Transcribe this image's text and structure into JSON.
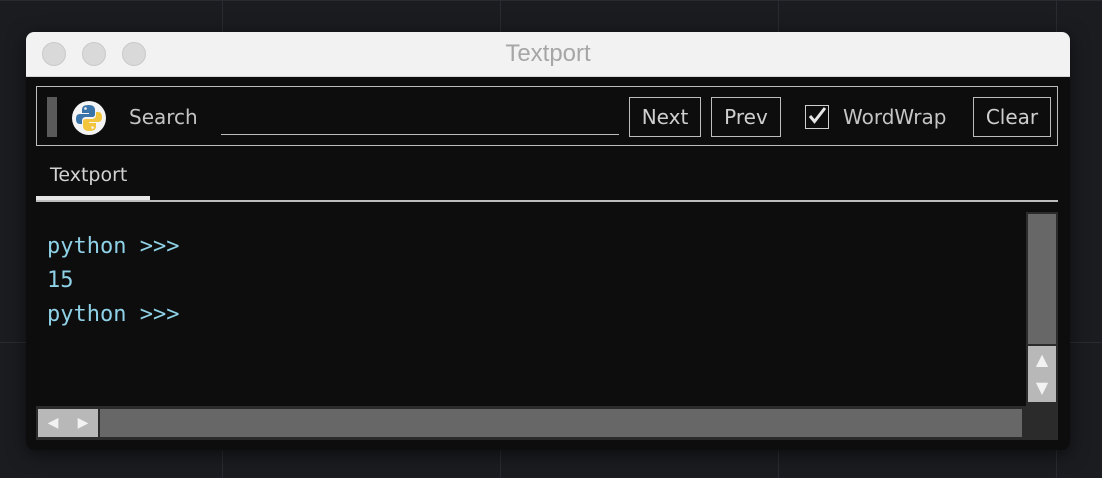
{
  "window": {
    "title": "Textport"
  },
  "toolbar": {
    "search_label": "Search",
    "search_value": "",
    "next_label": "Next",
    "prev_label": "Prev",
    "wordwrap_label": "WordWrap",
    "wordwrap_checked": true,
    "clear_label": "Clear"
  },
  "tabs": [
    {
      "label": "Textport",
      "active": true
    }
  ],
  "console": {
    "lines": [
      "python >>>",
      "15",
      "python >>>"
    ]
  },
  "scroll_arrows": {
    "up": "▲",
    "down": "▼",
    "left": "◀",
    "right": "▶"
  },
  "icons": {
    "app": "python-logo-icon"
  },
  "colors": {
    "console_text": "#8fd1e6",
    "background": "#0d0d0d"
  }
}
